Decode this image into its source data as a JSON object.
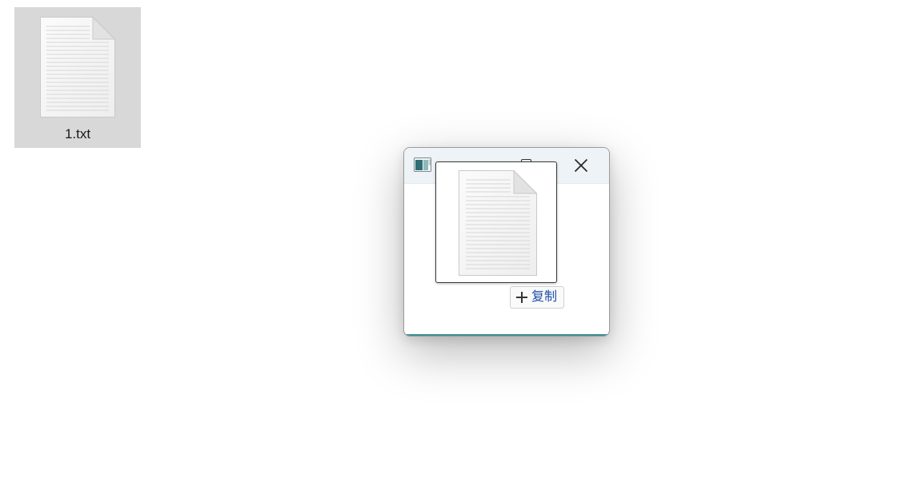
{
  "desktop": {
    "file_icon": {
      "label": "1.txt",
      "icon": "text-document-icon",
      "selected": true
    }
  },
  "window": {
    "app_icon": "app-icon",
    "controls": [
      "maximize-icon",
      "close-icon"
    ]
  },
  "drag_operation": {
    "icon": "plus-icon",
    "label": "复制"
  },
  "colors": {
    "selection": "#d8d8d8",
    "titlebar": "#eef3f7",
    "tooltip_text": "#1f4fa8",
    "accent": "#3a8f95"
  }
}
